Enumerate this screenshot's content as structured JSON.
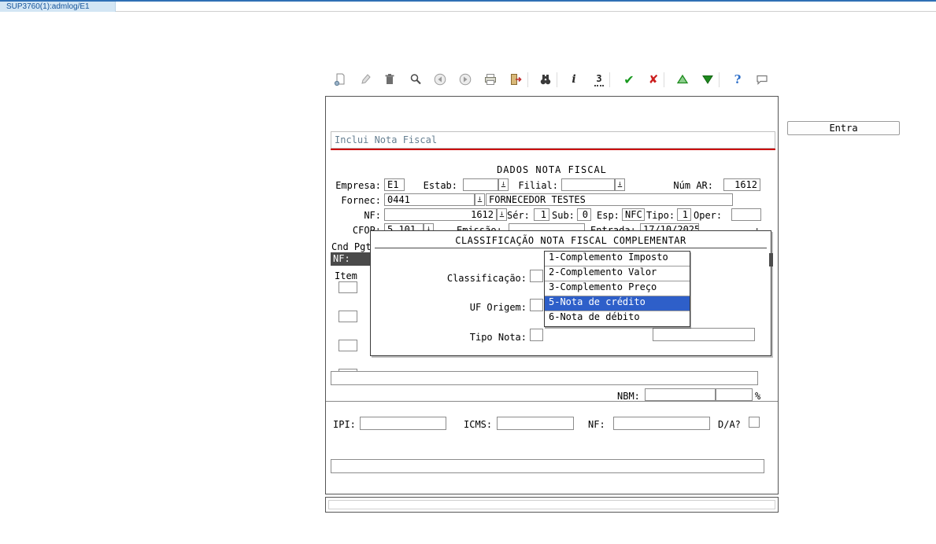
{
  "tab": {
    "title": "SUP3760(1):admlog/E1"
  },
  "toolbar": {
    "icons": [
      {
        "name": "new-record-icon"
      },
      {
        "name": "edit-icon"
      },
      {
        "name": "delete-icon"
      },
      {
        "name": "search-icon"
      },
      {
        "name": "previous-icon"
      },
      {
        "name": "next-icon"
      },
      {
        "name": "print-icon"
      },
      {
        "name": "exit-icon"
      },
      {
        "name": "find-icon"
      },
      {
        "name": "info-icon",
        "glyph": "i"
      },
      {
        "name": "goto-icon",
        "glyph": "3"
      },
      {
        "name": "confirm-icon",
        "glyph": "✔"
      },
      {
        "name": "cancel-icon",
        "glyph": "✘"
      },
      {
        "name": "first-icon"
      },
      {
        "name": "last-icon"
      },
      {
        "name": "help-icon",
        "glyph": "?"
      },
      {
        "name": "message-icon"
      }
    ]
  },
  "entra_button": {
    "label": "Entra"
  },
  "window": {
    "title": "Inclui Nota Fiscal",
    "section_title": "DADOS NOTA FISCAL",
    "fields": {
      "empresa_label": "Empresa:",
      "empresa": "E1",
      "estab_label": "Estab:",
      "estab": "",
      "filial_label": "Filial:",
      "filial": "",
      "num_ar_label": "Núm AR:",
      "num_ar": "1612",
      "fornec_label": "Fornec:",
      "fornec": "0441",
      "fornec_nome": "FORNECEDOR TESTES",
      "nf_label": "NF:",
      "nf": "1612",
      "ser_label": "Sér:",
      "ser": "1",
      "sub_label": "Sub:",
      "sub": "0",
      "esp_label": "Esp:",
      "esp": "NFC",
      "tipo_label": "Tipo:",
      "tipo": "1",
      "oper_label": "Oper:",
      "oper": "",
      "cfop_label": "CFOP:",
      "cfop": "5.101",
      "emissao_label": "Emissão:",
      "emissao": "",
      "entrada_label": "Entrada:",
      "entrada": "17/10/2025",
      "hora_colon": ":",
      "cnd_pgt_label": "Cnd Pgt",
      "nf_row_label": "NF:",
      "item_label": "Item",
      "nbm_label": "NBM:",
      "nbm1": "",
      "nbm2": "",
      "percent_label": "%",
      "ipi_label": "IPI:",
      "ipi": "",
      "icms_label": "ICMS:",
      "icms": "",
      "nf2_label": "NF:",
      "nf2": "",
      "da_label": "D/A?"
    }
  },
  "modal": {
    "title": "CLASSIFICAÇÃO NOTA FISCAL COMPLEMENTAR",
    "classificacao_label": "Classificação:",
    "uf_origem_label": "UF Origem:",
    "tipo_nota_label": "Tipo Nota:",
    "dropdown": {
      "items": [
        "1-Complemento Imposto",
        "2-Complemento Valor",
        "3-Complemento Preço",
        "5-Nota de crédito",
        "6-Nota de débito"
      ],
      "selected": "5-Nota de crédito",
      "selected_index": 3
    }
  },
  "colors": {
    "selection_blue": "#2e5fc9",
    "title_red_line": "#cc0000",
    "tab_blue": "#d3e6f4"
  }
}
